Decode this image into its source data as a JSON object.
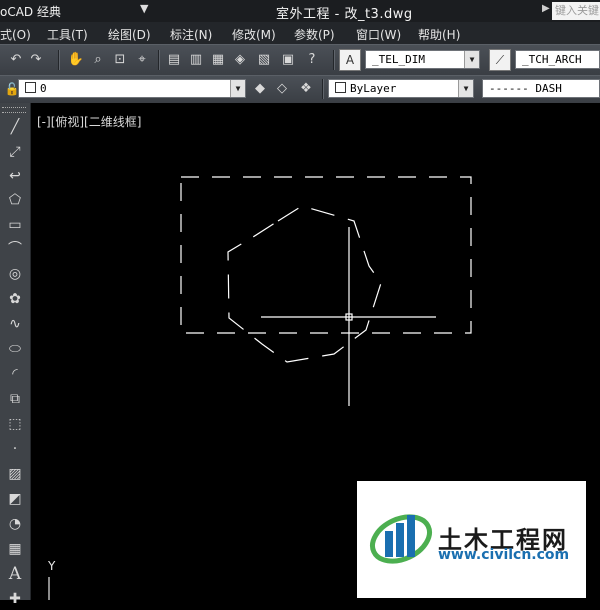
{
  "titlebar": {
    "workspace": "oCAD 经典",
    "doc_title": "室外工程 - 改_t3.dwg",
    "search_placeholder": "键入关键"
  },
  "menu": [
    {
      "label": "式(O)"
    },
    {
      "label": "工具(T)"
    },
    {
      "label": "绘图(D)"
    },
    {
      "label": "标注(N)"
    },
    {
      "label": "修改(M)"
    },
    {
      "label": "参数(P)"
    },
    {
      "label": "窗口(W)"
    },
    {
      "label": "帮助(H)"
    }
  ],
  "toolbar1": {
    "text_style": "_TEL_DIM",
    "dim_style": "_TCH_ARCH"
  },
  "toolbar2": {
    "layer": "0",
    "color": "ByLayer",
    "linetype": "------ DASH"
  },
  "left_tools": [
    {
      "icon": "line-icon",
      "glyph": "╱"
    },
    {
      "icon": "construction-line-icon",
      "glyph": "⤢"
    },
    {
      "icon": "polyline-icon",
      "glyph": "↩"
    },
    {
      "icon": "polygon-icon",
      "glyph": "⬠"
    },
    {
      "icon": "rectangle-icon",
      "glyph": "▭"
    },
    {
      "icon": "arc-icon",
      "glyph": "⌒"
    },
    {
      "icon": "circle-icon",
      "glyph": "◎"
    },
    {
      "icon": "revision-cloud-icon",
      "glyph": "✿"
    },
    {
      "icon": "spline-icon",
      "glyph": "∿"
    },
    {
      "icon": "ellipse-icon",
      "glyph": "⬭"
    },
    {
      "icon": "ellipse-arc-icon",
      "glyph": "◜"
    },
    {
      "icon": "insert-block-icon",
      "glyph": "⧉"
    },
    {
      "icon": "make-block-icon",
      "glyph": "⬚"
    },
    {
      "icon": "point-icon",
      "glyph": "·"
    },
    {
      "icon": "hatch-icon",
      "glyph": "▨"
    },
    {
      "icon": "gradient-icon",
      "glyph": "◩"
    },
    {
      "icon": "region-icon",
      "glyph": "◔"
    },
    {
      "icon": "table-icon",
      "glyph": "▦"
    },
    {
      "icon": "mtext-icon",
      "glyph": "A"
    },
    {
      "icon": "add-selected-icon",
      "glyph": "✚"
    }
  ],
  "canvas": {
    "view_label": "[-][俯视][二维线框]",
    "ucs_y_label": "Y"
  },
  "watermark": {
    "name_cn": "土木工程网",
    "url": "www.civilcn.com",
    "brand_blue": "#1a6fb0",
    "brand_green": "#4caf50"
  }
}
